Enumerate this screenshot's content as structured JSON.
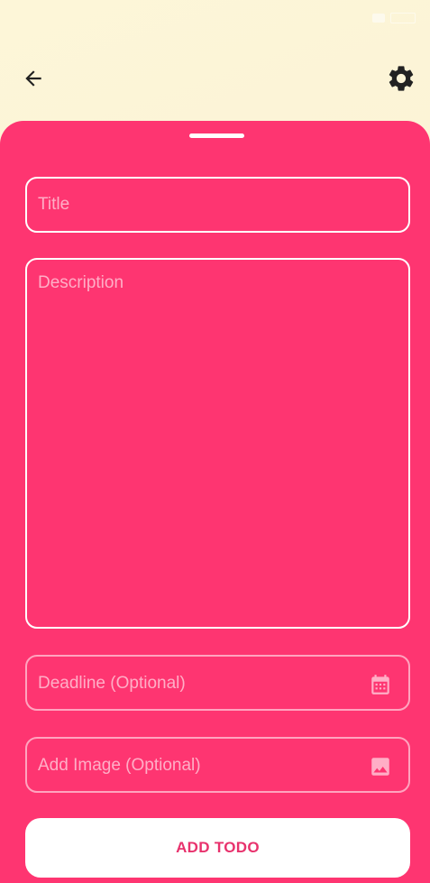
{
  "app_bar": {
    "back_icon": "arrow-left-icon",
    "settings_icon": "gear-icon"
  },
  "form": {
    "title_placeholder": "Title",
    "description_placeholder": "Description",
    "deadline_placeholder": "Deadline (Optional)",
    "deadline_icon": "calendar-icon",
    "image_placeholder": "Add Image (Optional)",
    "image_icon": "image-icon",
    "submit_label": "ADD TODO"
  },
  "colors": {
    "sheet": "#fe3571",
    "button_text": "#e8326d",
    "icon_dark": "#222222"
  }
}
